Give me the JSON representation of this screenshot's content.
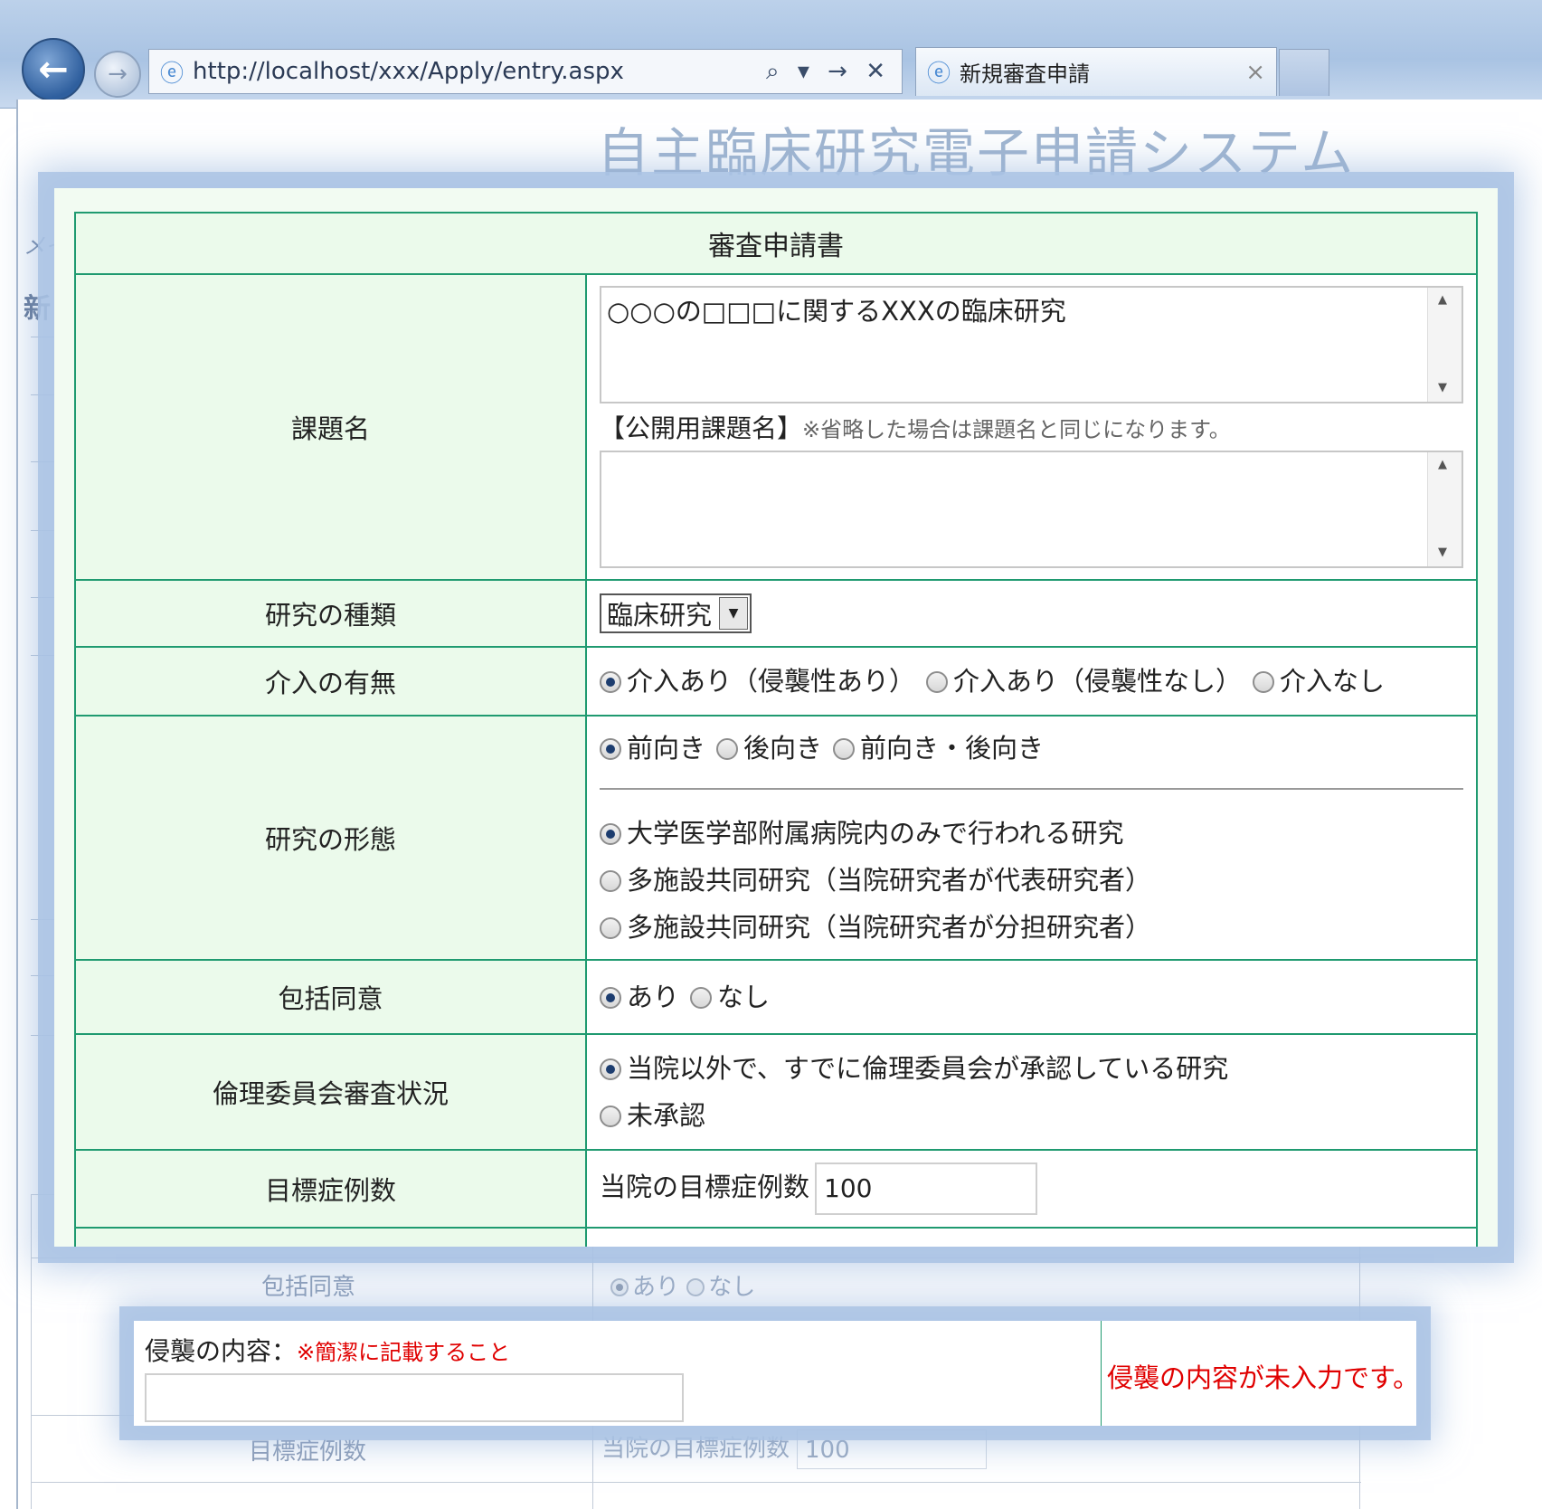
{
  "browser": {
    "url": "http://localhost/xxx/Apply/entry.aspx",
    "tab_title": "新規審査申請",
    "tab_close": "×",
    "addr_tools": "⌕ ▾ → ✕"
  },
  "site": {
    "title": "自主臨床研究電子申請システム",
    "side_text_1": "メイ",
    "side_text_2": "新"
  },
  "form": {
    "header": "審査申請書",
    "rows": {
      "title": {
        "label": "課題名",
        "value": "○○○の□□□に関するXXXの臨床研究",
        "public_label": "【公開用課題名】",
        "public_note": "※省略した場合は課題名と同じになります。",
        "public_value": ""
      },
      "type": {
        "label": "研究の種類",
        "selected": "臨床研究"
      },
      "intervention": {
        "label": "介入の有無",
        "options": [
          "介入あり（侵襲性あり）",
          "介入あり（侵襲性なし）",
          "介入なし"
        ]
      },
      "form_type": {
        "label": "研究の形態",
        "direction_options": [
          "前向き",
          "後向き",
          "前向き・後向き"
        ],
        "scope_options": [
          "大学医学部附属病院内のみで行われる研究",
          "多施設共同研究（当院研究者が代表研究者）",
          "多施設共同研究（当院研究者が分担研究者）"
        ]
      },
      "consent": {
        "label": "包括同意",
        "options": [
          "あり",
          "なし"
        ]
      },
      "ethics": {
        "label": "倫理委員会審査状況",
        "options": [
          "当院以外で、すでに倫理委員会が承認している研究",
          "未承認"
        ]
      },
      "cases": {
        "label": "目標症例数",
        "prefix": "当院の目標症例数",
        "value": "100"
      }
    }
  },
  "background": {
    "consent_label": "包括同意",
    "consent_yes": "あり",
    "consent_no": "なし",
    "cases_label": "目標症例数",
    "cases_prefix": "当院の目標症例数",
    "cases_value": "100"
  },
  "error_panel": {
    "label": "侵襲の内容：",
    "note": "※簡潔に記載すること",
    "message": "侵襲の内容が未入力です。"
  }
}
